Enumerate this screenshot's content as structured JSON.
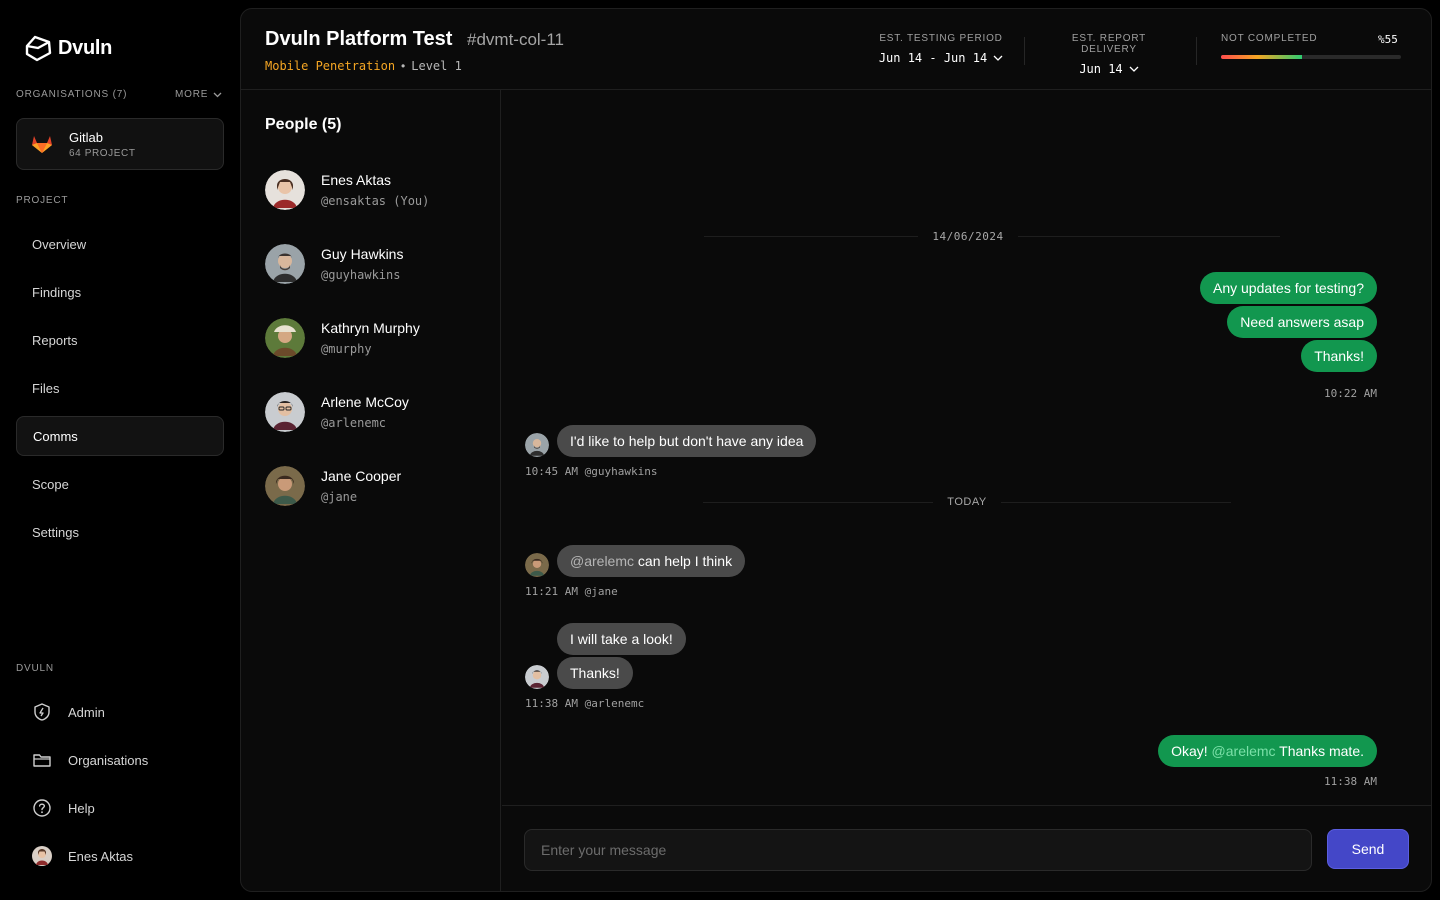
{
  "app": {
    "name": "Dvuln"
  },
  "organisations": {
    "label": "ORGANISATIONS (7)",
    "more_label": "MORE"
  },
  "org": {
    "name": "Gitlab",
    "sub": "64 PROJECT"
  },
  "project_section": {
    "label": "PROJECT",
    "items": [
      {
        "label": "Overview"
      },
      {
        "label": "Findings"
      },
      {
        "label": "Reports"
      },
      {
        "label": "Files"
      },
      {
        "label": "Comms",
        "active": true
      },
      {
        "label": "Scope"
      },
      {
        "label": "Settings"
      }
    ]
  },
  "dvuln_section": {
    "label": "DVULN",
    "items": [
      {
        "label": "Admin",
        "icon": "shield-icon"
      },
      {
        "label": "Organisations",
        "icon": "folder-icon"
      },
      {
        "label": "Help",
        "icon": "help-icon"
      },
      {
        "label": "Enes Aktas",
        "icon": "avatar"
      }
    ]
  },
  "header": {
    "title": "Dvuln Platform Test",
    "code": "#dvmt-col-11",
    "type": "Mobile Penetration",
    "separator": "•",
    "level": "Level 1",
    "testing_period": {
      "label": "EST. TESTING PERIOD",
      "value": "Jun 14 - Jun 14"
    },
    "report_delivery": {
      "label": "EST. REPORT DELIVERY",
      "value": "Jun 14"
    },
    "status": {
      "label": "NOT COMPLETED",
      "percent_text": "%55",
      "progress": 0.45
    }
  },
  "people": {
    "title": "People (5)",
    "list": [
      {
        "name": "Enes Aktas",
        "handle": "@ensaktas (You)"
      },
      {
        "name": "Guy Hawkins",
        "handle": "@guyhawkins"
      },
      {
        "name": "Kathryn Murphy",
        "handle": "@murphy"
      },
      {
        "name": "Arlene McCoy",
        "handle": "@arlenemc"
      },
      {
        "name": "Jane Cooper",
        "handle": "@jane"
      }
    ]
  },
  "chat": {
    "date1": "14/06/2024",
    "date2": "TODAY",
    "g1": {
      "m1": "Any updates for testing?",
      "m2": "Need answers asap",
      "m3": "Thanks!",
      "time": "10:22 AM"
    },
    "g2": {
      "m1": "I'd like to help but don't have any idea",
      "time": "10:45 AM",
      "handle": "@guyhawkins"
    },
    "g3": {
      "mention": "@arelemc",
      "rest": " can help I think",
      "time": "11:21 AM",
      "handle": "@jane"
    },
    "g4": {
      "m1": "I will take a look!",
      "m2": "Thanks!",
      "time": "11:38 AM",
      "handle": "@arlenemc"
    },
    "g5": {
      "pre": "Okay! ",
      "mention": "@arelemc",
      "post": " Thanks mate.",
      "time": "11:38 AM"
    }
  },
  "composer": {
    "placeholder": "Enter your message",
    "send_label": "Send"
  },
  "colors": {
    "accent": "#f5a623",
    "outgoing": "#12974f",
    "incoming": "#4a4a4a",
    "send": "#4447c8"
  }
}
